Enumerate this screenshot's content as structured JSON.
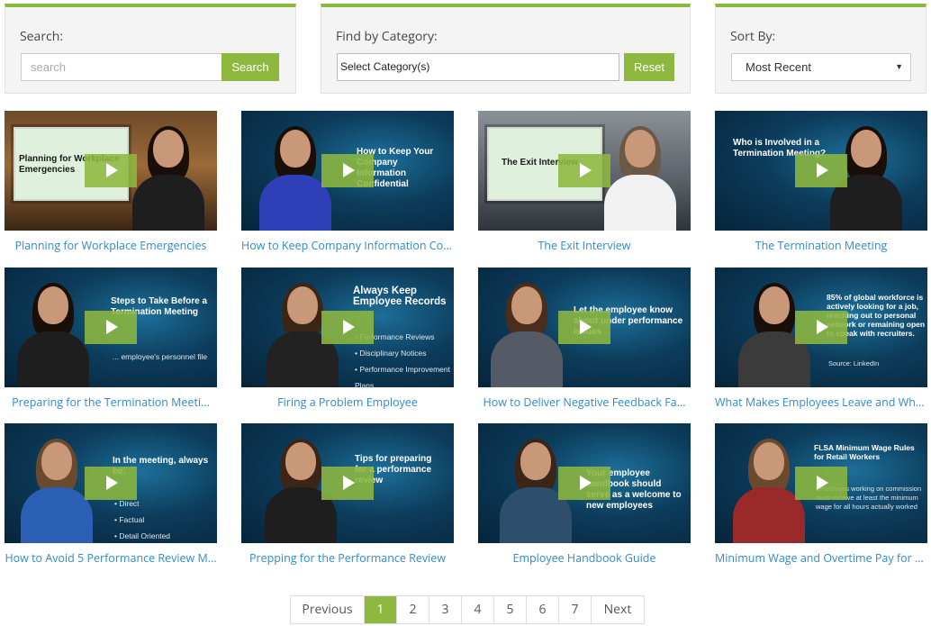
{
  "filters": {
    "search_label": "Search:",
    "search_placeholder": "search",
    "search_button": "Search",
    "category_label": "Find by Category:",
    "category_value": "Select Category(s)",
    "reset_button": "Reset",
    "sort_label": "Sort By:",
    "sort_value": "Most Recent"
  },
  "colors": {
    "accent": "#8db73f",
    "link": "#2e8bc9"
  },
  "videos": [
    {
      "title": "Planning for Workplace Emergencies",
      "thumb_text": "Planning for Workplace Emergencies"
    },
    {
      "title": "How to Keep Company Information Con...",
      "thumb_text": "How to Keep Your Company Information Confidential"
    },
    {
      "title": "The Exit Interview",
      "thumb_text": "The Exit Interview"
    },
    {
      "title": "The Termination Meeting",
      "thumb_text": "Who is Involved in a Termination Meeting?"
    },
    {
      "title": "Preparing for the Termination Meeti...",
      "thumb_text": "Steps to Take Before a Termination Meeting",
      "thumb_sub": [
        "... employee's personnel file"
      ]
    },
    {
      "title": "Firing a Problem Employee",
      "thumb_text": "Always Keep Employee Records",
      "thumb_sub": [
        "• Performance Reviews",
        "• Disciplinary Notices",
        "• Performance Improvement Plans"
      ]
    },
    {
      "title": "How to Deliver Negative Feedback Fa...",
      "thumb_text": "Let the employee know about under performance issues"
    },
    {
      "title": "What Makes Employees Leave and What...",
      "thumb_text": "85% of global workforce is actively looking for a job, reaching out to personal network or remaining open to speak with recruiters.",
      "thumb_sub": [
        "Source: LinkedIn"
      ]
    },
    {
      "title": "How to Avoid 5 Performance Review M...",
      "thumb_text": "In the meeting, always be:",
      "thumb_sub": [
        "• Direct",
        "• Factual",
        "• Detail Oriented"
      ]
    },
    {
      "title": "Prepping for the Performance Review",
      "thumb_text": "Tips for preparing for a performance review"
    },
    {
      "title": "Employee Handbook Guide",
      "thumb_text": "Your employee handbook should serve as a welcome to new employees"
    },
    {
      "title": "Minimum Wage and Overtime Pay for T...",
      "thumb_text": "FLSA Minimum Wage Rules for Retail Workers",
      "thumb_sub": [
        "Employees working on commission must receive at least the minimum wage for all hours actually worked"
      ]
    }
  ],
  "pagination": {
    "previous": "Previous",
    "pages": [
      "1",
      "2",
      "3",
      "4",
      "5",
      "6",
      "7"
    ],
    "current": "1",
    "next": "Next"
  }
}
